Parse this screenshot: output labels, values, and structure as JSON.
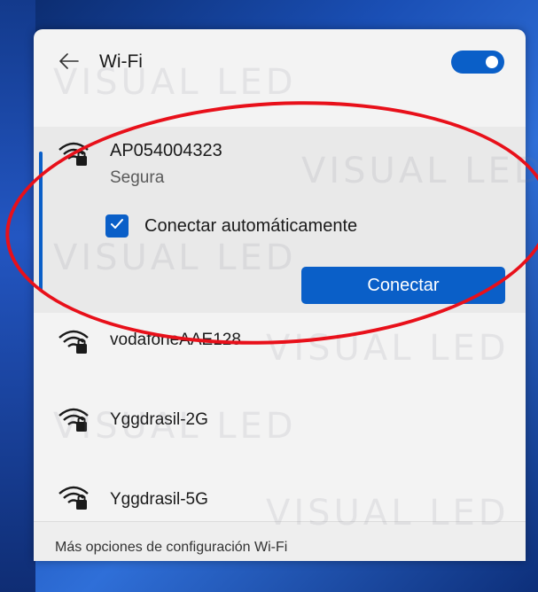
{
  "header": {
    "title": "Wi-Fi",
    "wifi_enabled": true
  },
  "selected_network": {
    "name": "AP054004323",
    "status": "Segura",
    "auto_connect_label": "Conectar automáticamente",
    "auto_connect_checked": true,
    "connect_label": "Conectar"
  },
  "networks": [
    {
      "name": "vodafoneAAE128"
    },
    {
      "name": "Yggdrasil-2G"
    },
    {
      "name": "Yggdrasil-5G"
    }
  ],
  "footer": {
    "more_options_label": "Más opciones de configuración Wi-Fi"
  },
  "watermark": {
    "text": "VISUAL LED"
  },
  "colors": {
    "accent": "#0a5fc8",
    "annotation": "#e8101a"
  },
  "icons": {
    "back": "arrow-left-icon",
    "network": "wifi-secured-icon",
    "checkbox": "checkmark-icon"
  }
}
